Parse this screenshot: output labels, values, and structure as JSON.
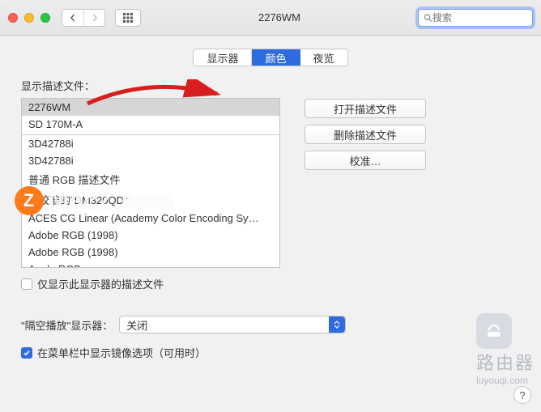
{
  "window": {
    "title": "2276WM",
    "search_placeholder": "搜索"
  },
  "tabs": [
    "显示器",
    "颜色",
    "夜览"
  ],
  "active_tab_index": 1,
  "profile_label": "显示描述文件：",
  "profiles": [
    "2276WM",
    "SD 170M-A",
    "3D42788i",
    "3D42788i",
    "普通 RGB 描述文件",
    "已校准的\"DM320QD\"",
    "ACES CG Linear (Academy Color Encoding Sy…",
    "Adobe RGB (1998)",
    "Adobe RGB (1998)",
    "Apple RGB"
  ],
  "show_only_checkbox_label": "仅显示此显示器的描述文件",
  "show_only_checked": false,
  "buttons": {
    "open": "打开描述文件",
    "delete": "删除描述文件",
    "calibrate": "校准…"
  },
  "airplay": {
    "label": "\"隔空播放\"显示器：",
    "value": "关闭"
  },
  "mirror_checkbox_label": "在菜单栏中显示镜像选项（可用时）",
  "mirror_checked": true,
  "watermark": {
    "brand": "MacZ.com",
    "logo_letter": "Z"
  },
  "router_wm": {
    "big": "路由器",
    "small": "luyouqi.com"
  }
}
